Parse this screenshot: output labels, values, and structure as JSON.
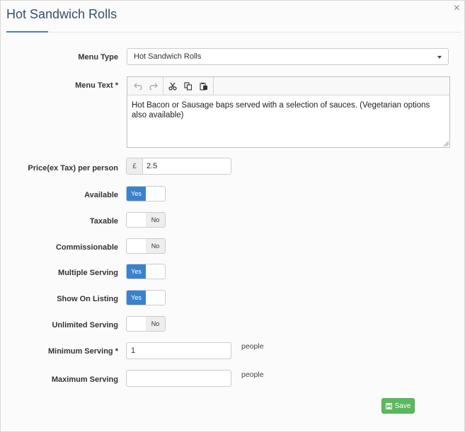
{
  "dialog": {
    "title": "Hot Sandwich Rolls",
    "close_label": "×"
  },
  "form": {
    "menu_type": {
      "label": "Menu Type",
      "value": "Hot Sandwich Rolls"
    },
    "menu_text": {
      "label": "Menu Text *",
      "value": "Hot Bacon or Sausage baps served with a selection of sauces. (Vegetarian options also available)"
    },
    "price": {
      "label": "Price(ex Tax) per person",
      "currency": "£",
      "value": "2.5"
    },
    "available": {
      "label": "Available",
      "state": "Yes"
    },
    "taxable": {
      "label": "Taxable",
      "state": "No"
    },
    "commissionable": {
      "label": "Commissionable",
      "state": "No"
    },
    "multiple_serving": {
      "label": "Multiple Serving",
      "state": "Yes"
    },
    "show_on_listing": {
      "label": "Show On Listing",
      "state": "Yes"
    },
    "unlimited_serving": {
      "label": "Unlimited Serving",
      "state": "No"
    },
    "minimum_serving": {
      "label": "Minimum Serving *",
      "value": "1",
      "suffix": "people"
    },
    "maximum_serving": {
      "label": "Maximum Serving",
      "value": "",
      "suffix": "people"
    }
  },
  "save_label": "Save",
  "colors": {
    "toggle_on": "#3a82cc",
    "save": "#5cb85c",
    "title": "#36506b"
  }
}
